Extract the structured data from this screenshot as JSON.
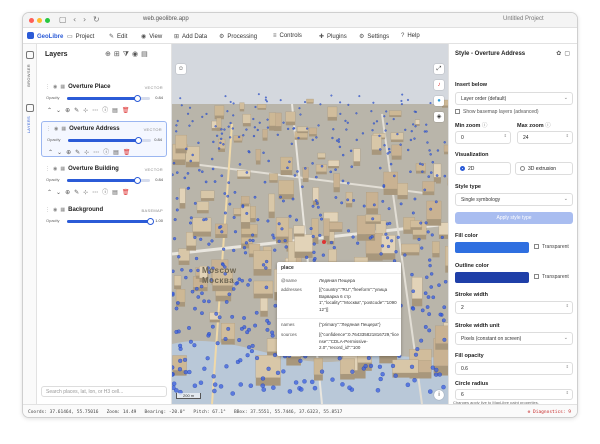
{
  "browser": {
    "url": "web.geolibre.app",
    "tab_title": "Untitled Project"
  },
  "menu": {
    "brand": "GeoLibre",
    "items": [
      {
        "label": "Project",
        "icon": "file-icon"
      },
      {
        "label": "Edit",
        "icon": "pencil-icon"
      },
      {
        "label": "View",
        "icon": "eye-icon"
      },
      {
        "label": "Add Data",
        "icon": "plus-icon"
      },
      {
        "label": "Processing",
        "icon": "gear-icon"
      },
      {
        "label": "Controls",
        "icon": "sliders-icon"
      },
      {
        "label": "Plugins",
        "icon": "puzzle-icon"
      },
      {
        "label": "Settings",
        "icon": "settings-icon"
      },
      {
        "label": "Help",
        "icon": "help-icon"
      }
    ]
  },
  "rail": {
    "browser_label": "BROWSER",
    "layers_label": "LAYERS"
  },
  "layers_panel": {
    "title": "Layers",
    "search_placeholder": "Search places, lat, lon, or H3 cell...",
    "layers": [
      {
        "name": "Overture Place",
        "type": "VECTOR",
        "opacity_label": "Opacity",
        "opacity": "0.84",
        "opacity_value": 0.84,
        "selected": false,
        "has_tools": true
      },
      {
        "name": "Overture Address",
        "type": "VECTOR",
        "opacity_label": "Opacity",
        "opacity": "0.84",
        "opacity_value": 0.84,
        "selected": true,
        "has_tools": true
      },
      {
        "name": "Overture Building",
        "type": "VECTOR",
        "opacity_label": "Opacity",
        "opacity": "0.84",
        "opacity_value": 0.84,
        "selected": false,
        "has_tools": true
      },
      {
        "name": "Background",
        "type": "BASEMAP",
        "opacity_label": "Opacity",
        "opacity": "1.00",
        "opacity_value": 1.0,
        "selected": false,
        "has_tools": false
      }
    ]
  },
  "map": {
    "city_label_latin": "Moscow",
    "city_label_cyrillic": "Москва",
    "scale": "200 m",
    "popup": {
      "title": "place",
      "rows": [
        {
          "key": "@name",
          "value": "Ледяная Пещера"
        },
        {
          "key": "addresses",
          "value": "[{\"country\":\"RU\",\"freeform\":\"улица Варварка 6 стр 1\",\"locality\":\"Москва\",\"postcode\":\"109012\"}]"
        },
        {
          "key": "names",
          "value": "{\"primary\":\"Ледяная Пещера\"}"
        },
        {
          "key": "sources",
          "value": "[{\"confidence\":0.764335821816729,\"license\":\"CDLA-Permissive-2.0\",\"record_id\":\"100"
        }
      ]
    }
  },
  "style_panel": {
    "title": "Style - Overture Address",
    "insert_below_label": "Insert below",
    "insert_below_value": "Layer order (default)",
    "show_basemap_label": "Show basemap layers (advanced)",
    "min_zoom_label": "Min zoom",
    "min_zoom": "0",
    "max_zoom_label": "Max zoom",
    "max_zoom": "24",
    "visualization_label": "Visualization",
    "viz_2d": "2D",
    "viz_3d": "3D extrusion",
    "style_type_label": "Style type",
    "style_type_value": "Single symbology",
    "apply_label": "Apply style type",
    "fill_color_label": "Fill color",
    "fill_color": "#2f6fe0",
    "outline_color_label": "Outline color",
    "outline_color": "#1f3fa8",
    "transparent_label": "Transparent",
    "stroke_width_label": "Stroke width",
    "stroke_width": "2",
    "stroke_unit_label": "Stroke width unit",
    "stroke_unit_value": "Pixels (constant on screen)",
    "fill_opacity_label": "Fill opacity",
    "fill_opacity": "0.6",
    "circle_radius_label": "Circle radius",
    "circle_radius": "6",
    "note": "Changes apply live to MapLibre paint properties."
  },
  "status": {
    "coords": "Coords: 37.61464, 55.75016",
    "zoom": "Zoom: 14.49",
    "bearing": "Bearing: -20.0°",
    "pitch": "Pitch: 67.1°",
    "bbox": "BBox: 37.5551, 55.7446, 37.6323, 55.8517",
    "diagnostics": "⊗ Diagnostics: 9"
  },
  "colors": {
    "accent": "#2b5bd7",
    "error": "#c62828"
  }
}
